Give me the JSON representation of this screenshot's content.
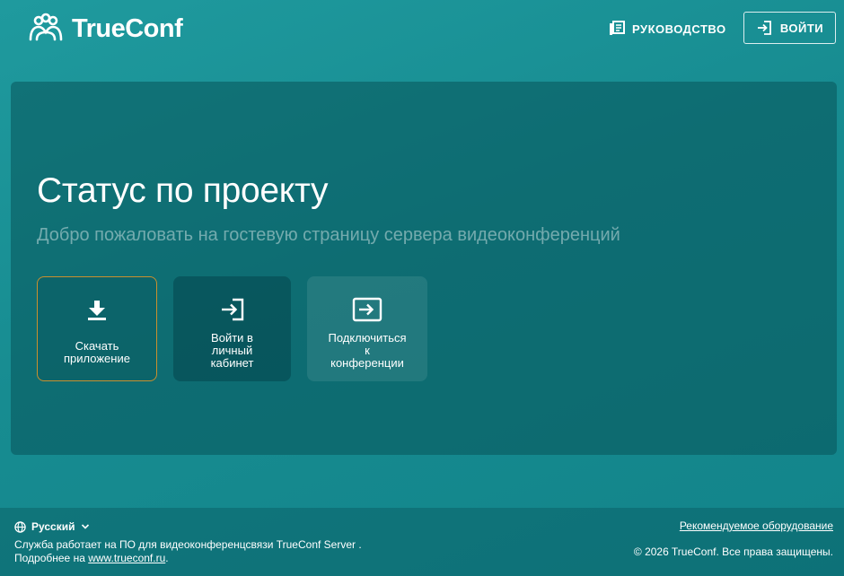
{
  "header": {
    "logo_text": "TrueConf",
    "guide_label": "РУКОВОДСТВО",
    "login_label": "ВОЙТИ"
  },
  "main": {
    "title": "Статус по проекту",
    "subtitle": "Добро пожаловать на гостевую страницу сервера видеоконференций",
    "tiles": [
      {
        "label_lines": [
          "Скачать",
          "приложение"
        ],
        "icon": "download-icon"
      },
      {
        "label_lines": [
          "Войти в",
          "личный",
          "кабинет"
        ],
        "icon": "login-icon"
      },
      {
        "label_lines": [
          "Подключиться",
          "к",
          "конференции"
        ],
        "icon": "join-conference-icon"
      }
    ]
  },
  "footer": {
    "language": "Русский",
    "service_text": "Служба работает на ПО для видеоконференцсвязи TrueConf Server .",
    "more_text": "Подробнее на",
    "more_link": "www.trueconf.ru",
    "more_suffix": ".",
    "recommended_link": "Рекомендуемое оборудование",
    "copyright": "© 2026 TrueConf. Все права защищены."
  },
  "colors": {
    "background": "#178c91",
    "panel": "#0d6a70",
    "tile_border_accent": "#c9902e",
    "text": "#ffffff"
  }
}
